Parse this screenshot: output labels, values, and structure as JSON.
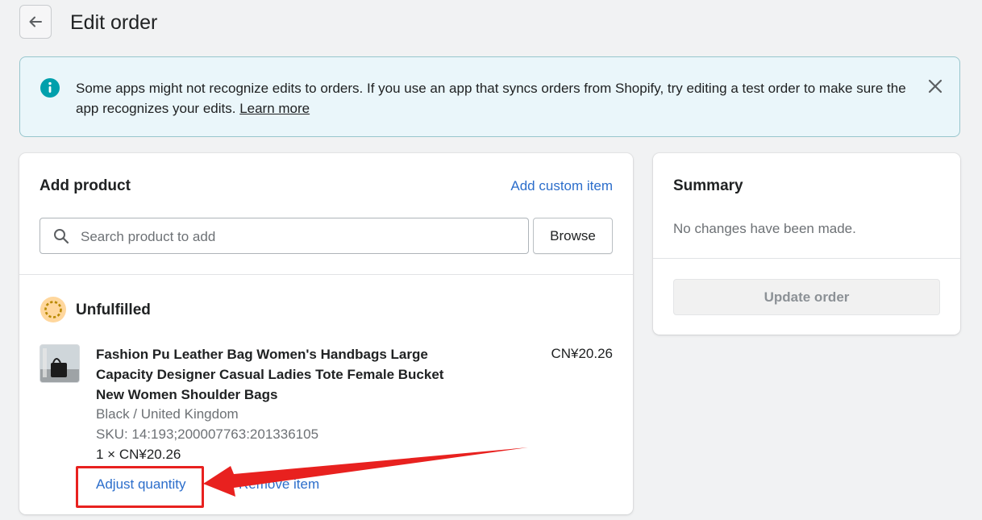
{
  "header": {
    "title": "Edit order"
  },
  "banner": {
    "message": "Some apps might not recognize edits to orders. If you use an app that syncs orders from Shopify, try editing a test order to make sure the app recognizes your edits.",
    "link": "Learn more"
  },
  "add_product": {
    "title": "Add product",
    "custom_link": "Add custom item",
    "search_placeholder": "Search product to add",
    "browse_label": "Browse"
  },
  "fulfillment": {
    "status": "Unfulfilled",
    "items": [
      {
        "name": "Fashion Pu Leather Bag Women's Handbags Large Capacity Designer Casual Ladies Tote Female Bucket New Women Shoulder Bags",
        "price": "CN¥20.26",
        "variant": "Black / United Kingdom",
        "sku": "SKU: 14:193;200007763:201336105",
        "quantity_line": "1 × CN¥20.26",
        "adjust_label": "Adjust quantity",
        "remove_label": "Remove item"
      }
    ]
  },
  "summary": {
    "title": "Summary",
    "note": "No changes have been made.",
    "update_label": "Update order"
  },
  "colors": {
    "link": "#2c6ecb",
    "annotation": "#e8211f",
    "banner_bg": "#eaf6fa",
    "info": "#00a0ac"
  }
}
